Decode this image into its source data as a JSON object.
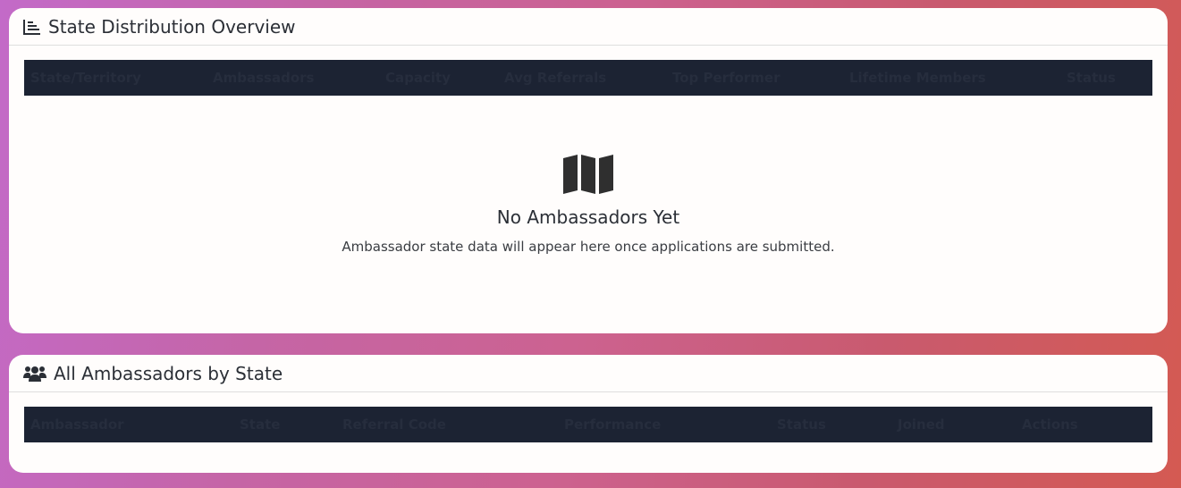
{
  "state_overview": {
    "title": "State Distribution Overview",
    "columns": [
      "State/Territory",
      "Ambassadors",
      "Capacity",
      "Avg Referrals",
      "Top Performer",
      "Lifetime Members",
      "Status"
    ],
    "empty_title": "No Ambassadors Yet",
    "empty_text": "Ambassador state data will appear here once applications are submitted."
  },
  "ambassadors_by_state": {
    "title": "All Ambassadors by State",
    "columns": [
      "Ambassador",
      "State",
      "Referral Code",
      "Performance",
      "Status",
      "Joined",
      "Actions"
    ]
  },
  "icons": {
    "overview": "bar-chart-icon",
    "empty": "map-icon",
    "ambassadors": "users-icon"
  },
  "colors": {
    "table_header_bg": "#1c2333",
    "table_header_text": "#262d3d",
    "card_bg": "#fffdfc"
  }
}
